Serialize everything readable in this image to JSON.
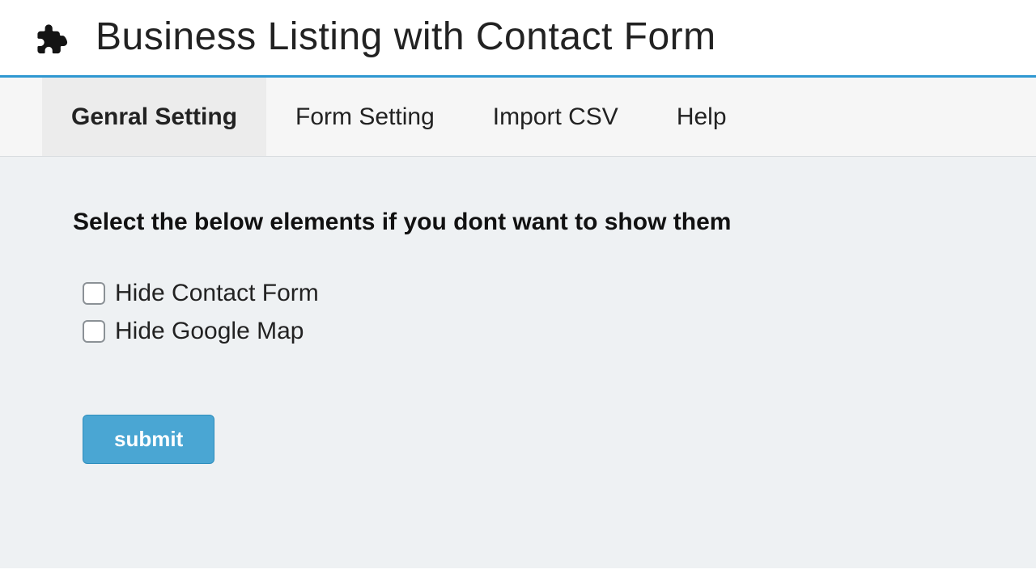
{
  "header": {
    "title": "Business Listing with Contact Form",
    "icon": "puzzle-piece"
  },
  "tabs": [
    {
      "label": "Genral Setting",
      "active": true
    },
    {
      "label": "Form Setting",
      "active": false
    },
    {
      "label": "Import CSV",
      "active": false
    },
    {
      "label": "Help",
      "active": false
    }
  ],
  "panel": {
    "heading": "Select the below elements if you dont want to show them",
    "options": [
      {
        "label": "Hide Contact Form",
        "checked": false
      },
      {
        "label": "Hide Google Map",
        "checked": false
      }
    ],
    "submit_label": "submit"
  },
  "colors": {
    "accent": "#2f98d1",
    "tabbar_bg": "#f6f6f6",
    "panel_bg": "#eef1f3",
    "button_bg": "#4aa6d3"
  }
}
